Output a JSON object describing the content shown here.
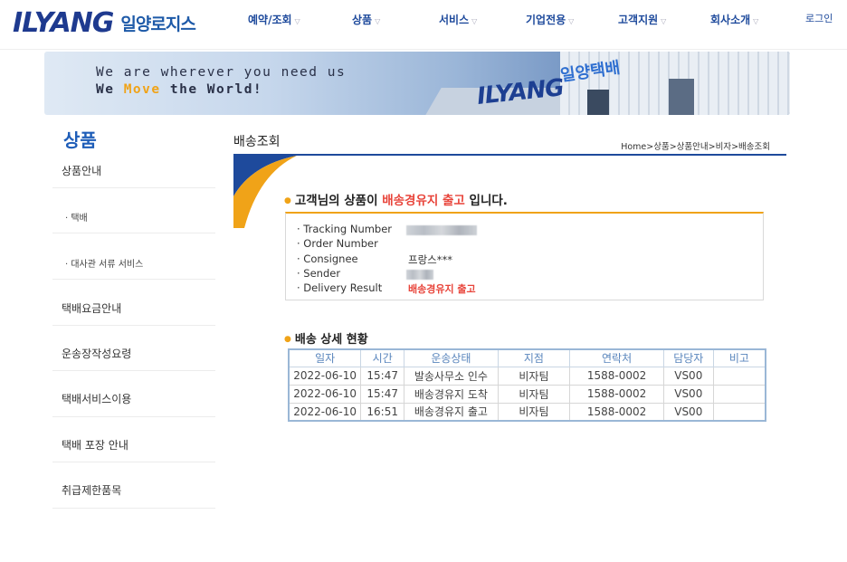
{
  "header": {
    "logo_text": "ILYANG",
    "logo_kor": "일양로지스",
    "nav": [
      "예약/조회",
      "상품",
      "서비스",
      "기업전용",
      "고객지원",
      "회사소개"
    ],
    "login": "로그인"
  },
  "banner": {
    "line1": "We are wherever you need us",
    "line2_pre": "We ",
    "line2_hl": "Move",
    "line2_post": " the World!",
    "building_logo": "ILYANG",
    "building_kor": "일양택배"
  },
  "sidebar": {
    "title": "상품",
    "items": [
      "상품안내",
      "· 택배",
      "· 대사관 서류 서비스",
      "택배요금안내",
      "운송장작성요령",
      "택배서비스이용",
      "택배 포장 안내",
      "취급제한품목"
    ]
  },
  "main": {
    "title": "배송조회",
    "breadcrumb": "Home>상품>상품안내>비자>배송조회",
    "result_pre": "고객님의 상품이 ",
    "result_status": "배송경유지 출고",
    "result_post": " 입니다.",
    "info_labels": [
      "· Tracking Number",
      "· Order Number",
      "· Consignee",
      "· Sender",
      "· Delivery Result"
    ],
    "consignee": "프랑스***",
    "delivery_result": "배송경유지 출고",
    "detail_heading": "배송 상세 현황"
  },
  "table": {
    "headers": [
      "일자",
      "시간",
      "운송상태",
      "지점",
      "연락처",
      "담당자",
      "비고"
    ],
    "rows": [
      [
        "2022-06-10",
        "15:47",
        "발송사무소 인수",
        "비자팀",
        "1588-0002",
        "VS00",
        ""
      ],
      [
        "2022-06-10",
        "15:47",
        "배송경유지 도착",
        "비자팀",
        "1588-0002",
        "VS00",
        ""
      ],
      [
        "2022-06-10",
        "16:51",
        "배송경유지 출고",
        "비자팀",
        "1588-0002",
        "VS00",
        ""
      ]
    ]
  },
  "colors": {
    "brand_blue": "#1e4a9c",
    "accent_orange": "#f0a318",
    "status_red": "#e8443a"
  }
}
